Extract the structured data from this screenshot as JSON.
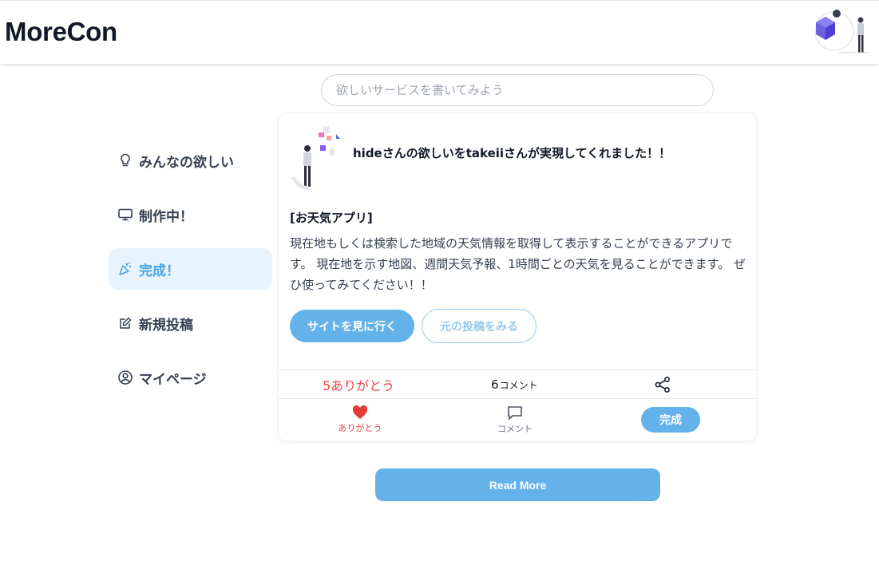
{
  "app": {
    "title": "MoreCon"
  },
  "search": {
    "placeholder": "欲しいサービスを書いてみよう"
  },
  "sidebar": {
    "items": [
      {
        "label": "みんなの欲しい",
        "icon": "lightbulb-icon",
        "active": false
      },
      {
        "label": "制作中！",
        "icon": "monitor-icon",
        "active": false
      },
      {
        "label": "完成！",
        "icon": "party-popper-icon",
        "active": true
      },
      {
        "label": "新規投稿",
        "icon": "edit-icon",
        "active": false
      },
      {
        "label": "マイページ",
        "icon": "user-circle-icon",
        "active": false
      }
    ]
  },
  "post": {
    "headline": "hideさんの欲しいをtakeiiさんが実現してくれました！！",
    "title": "[お天気アプリ]",
    "description": "現在地もしくは検索した地域の天気情報を取得して表示することができるアプリです。 現在地を示す地図、週間天気予報、1時間ごとの天気を見ることができます。 ぜひ使ってみてください！！",
    "primary_button": "サイトを見に行く",
    "secondary_button": "元の投稿をみる",
    "stats": {
      "thanks": "5ありがとう",
      "comment_count": "6",
      "comment_unit": "コメント"
    },
    "actions": {
      "thanks_label": "ありがとう",
      "comment_label": "コメント",
      "status_badge": "完成"
    }
  },
  "read_more": "Read More",
  "colors": {
    "accent": "#63b3ea",
    "active_bg": "#e8f4fd",
    "thanks_red": "#ef4444"
  }
}
